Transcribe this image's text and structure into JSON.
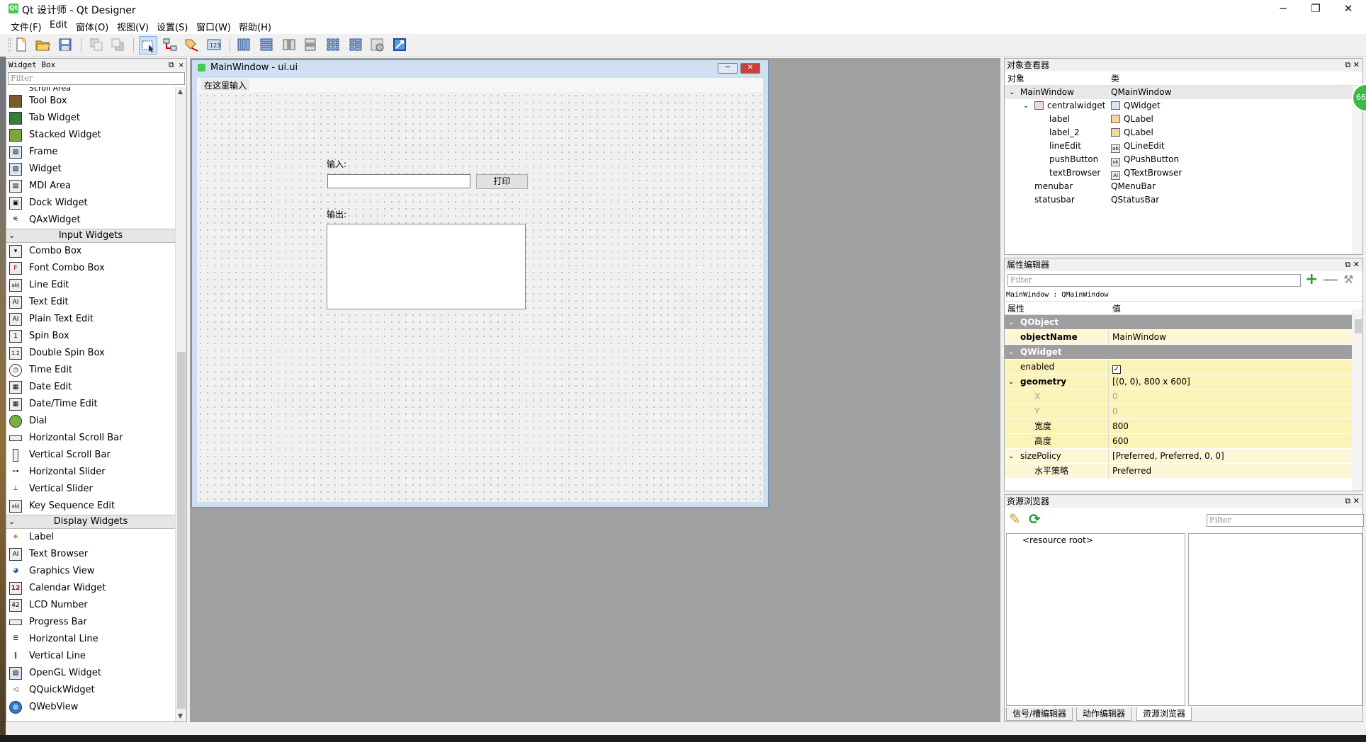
{
  "app": {
    "window_title": "Qt 设计师 - Qt Designer",
    "controls": {
      "minimize": "─",
      "restore": "❐",
      "close": "✕"
    }
  },
  "menu": [
    "文件(F)",
    "Edit",
    "窗体(O)",
    "视图(V)",
    "设置(S)",
    "窗口(W)",
    "帮助(H)"
  ],
  "widget_box": {
    "title": "Widget Box",
    "filter_placeholder": "Filter",
    "partial_top": "Scroll Area",
    "groups": [
      {
        "items": [
          "Tool Box",
          "Tab Widget",
          "Stacked Widget",
          "Frame",
          "Widget",
          "MDI Area",
          "Dock Widget",
          "QAxWidget"
        ]
      },
      {
        "name": "Input Widgets",
        "items": [
          "Combo Box",
          "Font Combo Box",
          "Line Edit",
          "Text Edit",
          "Plain Text Edit",
          "Spin Box",
          "Double Spin Box",
          "Time Edit",
          "Date Edit",
          "Date/Time Edit",
          "Dial",
          "Horizontal Scroll Bar",
          "Vertical Scroll Bar",
          "Horizontal Slider",
          "Vertical Slider",
          "Key Sequence Edit"
        ]
      },
      {
        "name": "Display Widgets",
        "items": [
          "Label",
          "Text Browser",
          "Graphics View",
          "Calendar Widget",
          "LCD Number",
          "Progress Bar",
          "Horizontal Line",
          "Vertical Line",
          "OpenGL Widget",
          "QQuickWidget",
          "QWebView"
        ]
      }
    ]
  },
  "form": {
    "title": "MainWindow - ui.ui",
    "menu_placeholder": "在这里输入",
    "input_label": "输入:",
    "print_button": "打印",
    "output_label": "输出:"
  },
  "object_inspector": {
    "title": "对象查看器",
    "col_object": "对象",
    "col_class": "类",
    "rows": [
      {
        "name": "MainWindow",
        "class": "QMainWindow",
        "level": 0
      },
      {
        "name": "centralwidget",
        "class": "QWidget",
        "level": 1
      },
      {
        "name": "label",
        "class": "QLabel",
        "level": 2
      },
      {
        "name": "label_2",
        "class": "QLabel",
        "level": 2
      },
      {
        "name": "lineEdit",
        "class": "QLineEdit",
        "level": 2
      },
      {
        "name": "pushButton",
        "class": "QPushButton",
        "level": 2
      },
      {
        "name": "textBrowser",
        "class": "QTextBrowser",
        "level": 2
      },
      {
        "name": "menubar",
        "class": "QMenuBar",
        "level": 1
      },
      {
        "name": "statusbar",
        "class": "QStatusBar",
        "level": 1
      }
    ]
  },
  "property_editor": {
    "title": "属性编辑器",
    "filter_placeholder": "Filter",
    "context": "MainWindow : QMainWindow",
    "col_property": "属性",
    "col_value": "值",
    "rows": [
      {
        "type": "group",
        "key": "QObject"
      },
      {
        "type": "prop",
        "key": "objectName",
        "value": "MainWindow",
        "bold": true
      },
      {
        "type": "group",
        "key": "QWidget"
      },
      {
        "type": "prop",
        "key": "enabled",
        "value": "☑"
      },
      {
        "type": "prop",
        "key": "geometry",
        "value": "[(0, 0), 800 x 600]",
        "bold": true,
        "expand": true
      },
      {
        "type": "sub",
        "key": "X",
        "value": "0",
        "disabled": true
      },
      {
        "type": "sub",
        "key": "Y",
        "value": "0",
        "disabled": true
      },
      {
        "type": "sub",
        "key": "宽度",
        "value": "800"
      },
      {
        "type": "sub",
        "key": "高度",
        "value": "600"
      },
      {
        "type": "prop",
        "key": "sizePolicy",
        "value": "[Preferred, Preferred, 0, 0]",
        "expand": true
      },
      {
        "type": "sub",
        "key": "水平策略",
        "value": "Preferred"
      }
    ]
  },
  "resource_browser": {
    "title": "资源浏览器",
    "filter_placeholder": "Filter",
    "root": "<resource root>"
  },
  "bottom_tabs": [
    "信号/槽编辑器",
    "动作编辑器",
    "资源浏览器"
  ],
  "badge": "66"
}
